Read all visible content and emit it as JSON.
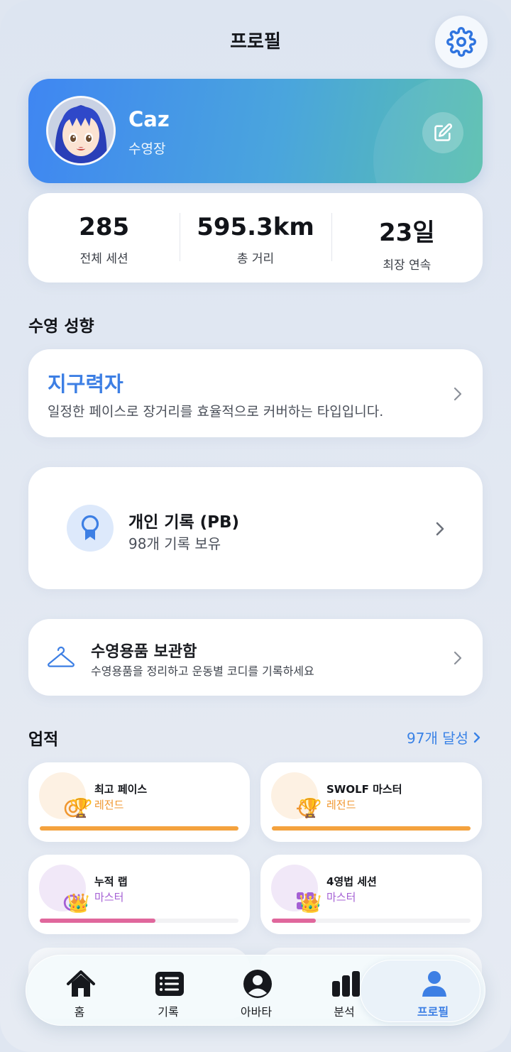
{
  "header": {
    "title": "프로필",
    "settings_icon": "gear-icon"
  },
  "profile": {
    "name": "Caz",
    "role": "수영장",
    "edit_icon": "edit-icon"
  },
  "stats": [
    {
      "value": "285",
      "label": "전체 세션"
    },
    {
      "value": "595.3km",
      "label": "총 거리"
    },
    {
      "value": "23일",
      "label": "최장 연속"
    }
  ],
  "swim_style": {
    "section_title": "수영 성향",
    "type_name": "지구력자",
    "description": "일정한 페이스로 장거리를 효율적으로 커버하는 타입입니다."
  },
  "pb": {
    "title": "개인 기록 (PB)",
    "subtitle": "98개 기록 보유"
  },
  "gear": {
    "title": "수영용품 보관함",
    "subtitle": "수영용품을 정리하고 운동별 코디를 기록하세요"
  },
  "achievements": {
    "section_title": "업적",
    "count_label": "97개 달성",
    "items": [
      {
        "name": "최고 페이스",
        "tier": "레전드",
        "tier_color": "#f0962e",
        "progress": 1.0
      },
      {
        "name": "SWOLF 마스터",
        "tier": "레전드",
        "tier_color": "#f0962e",
        "progress": 1.0
      },
      {
        "name": "누적 랩",
        "tier": "마스터",
        "tier_color": "#a45fd4",
        "progress": 0.58
      },
      {
        "name": "4영법 세션",
        "tier": "마스터",
        "tier_color": "#a45fd4",
        "progress": 0.22
      }
    ]
  },
  "tabbar": {
    "tabs": [
      {
        "label": "홈",
        "icon": "home-icon"
      },
      {
        "label": "기록",
        "icon": "list-icon"
      },
      {
        "label": "아바타",
        "icon": "avatar-icon"
      },
      {
        "label": "분석",
        "icon": "bar-chart-icon"
      },
      {
        "label": "프로필",
        "icon": "person-icon"
      }
    ],
    "active": "프로필"
  },
  "colors": {
    "accent": "#3d7fe4",
    "legend": "#f0962e",
    "master": "#a45fd4"
  }
}
